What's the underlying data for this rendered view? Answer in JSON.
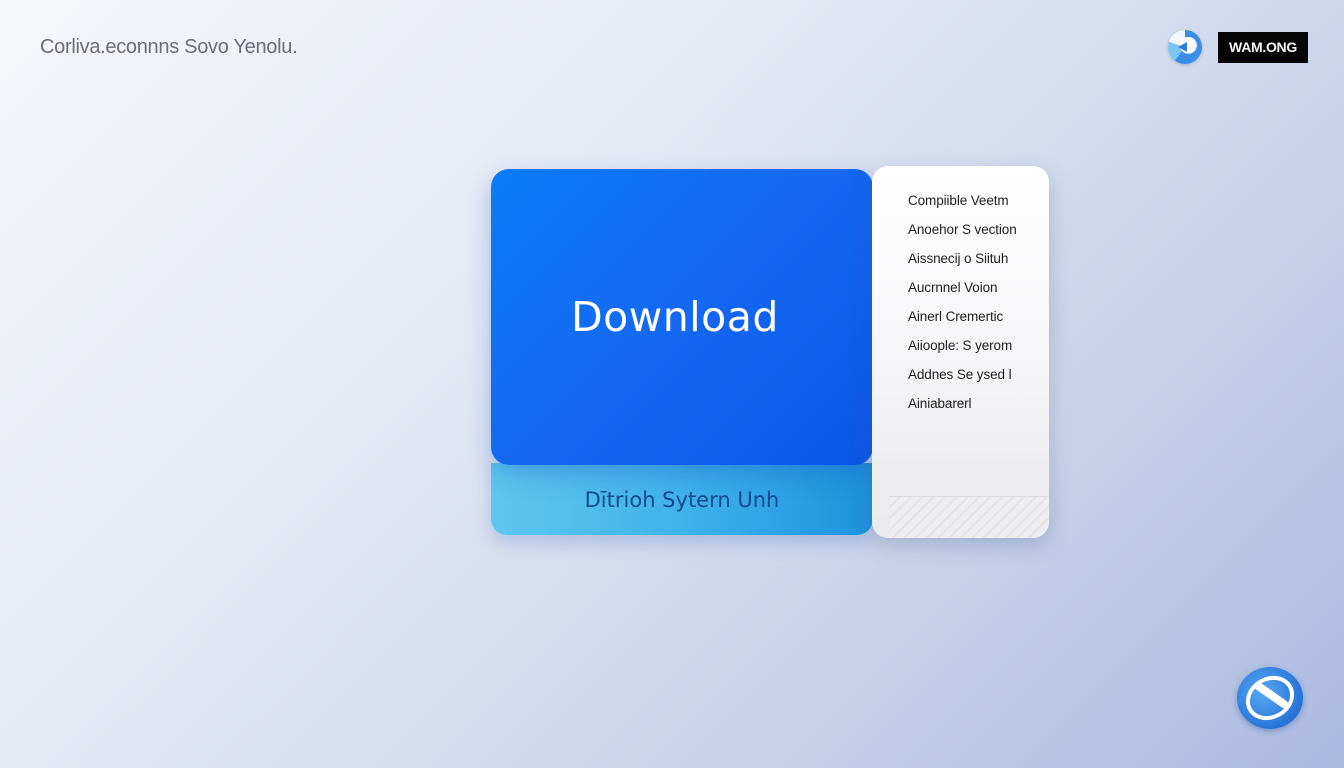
{
  "header": {
    "app_title": "Corliva.econnns Sovo Yenolu.",
    "domain_badge": "WAM.ONG",
    "browser_icon": "browser-logo-icon"
  },
  "primary_card": {
    "label": "Download",
    "accent_color": "#1468f2"
  },
  "secondary_card": {
    "label": "Dītrioh Sytern Unh",
    "accent_color": "#3fb2ea"
  },
  "versions_panel": {
    "items": [
      "Compiible Veetm",
      "Anoehor S vection",
      "Aissnecij o Siituh",
      "Aucrnnel Voion",
      "Ainerl Cremertic",
      "Aiioople: S yerom",
      "Addnes Se ysed l",
      "Ainiabarerl"
    ]
  },
  "footer": {
    "corner_icon": "globe-icon"
  }
}
